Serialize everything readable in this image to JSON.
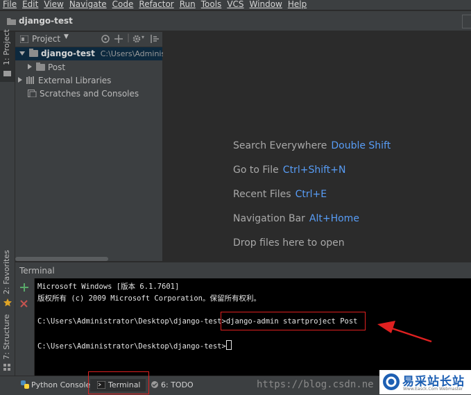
{
  "menu": [
    "File",
    "Edit",
    "View",
    "Navigate",
    "Code",
    "Refactor",
    "Run",
    "Tools",
    "VCS",
    "Window",
    "Help"
  ],
  "navbar": {
    "project_title": "django-test"
  },
  "left_strip": {
    "project_tab": "1: Project",
    "favorites_tab": "2: Favorites",
    "structure_tab": "7: Structure"
  },
  "project_panel": {
    "header_label": "Project",
    "tree": {
      "root_name": "django-test",
      "root_path": "C:\\Users\\Administrat",
      "child_post": "Post",
      "external_libraries": "External Libraries",
      "scratches": "Scratches and Consoles"
    }
  },
  "editor_hints": {
    "search_label": "Search Everywhere",
    "search_key": "Double Shift",
    "goto_label": "Go to File",
    "goto_key": "Ctrl+Shift+N",
    "recent_label": "Recent Files",
    "recent_key": "Ctrl+E",
    "navbar_label": "Navigation Bar",
    "navbar_key": "Alt+Home",
    "drop_label": "Drop files here to open"
  },
  "terminal": {
    "title": "Terminal",
    "line1": "Microsoft Windows [版本 6.1.7601]",
    "line2": "版权所有 (c) 2009 Microsoft Corporation。保留所有权利。",
    "prompt1": "C:\\Users\\Administrator\\Desktop\\django-test>",
    "command": "django-admin startproject Post",
    "prompt2": "C:\\Users\\Administrator\\Desktop\\django-test>"
  },
  "bottom_tabs": {
    "python_console": "Python Console",
    "terminal": "Terminal",
    "todo": "6: TODO"
  },
  "watermark": {
    "url": "https://blog.csdn.ne",
    "brand": "易采站长站",
    "brand_sub": "Www.Easck.Com Webmaster"
  },
  "colors": {
    "accent_key": "#589df6",
    "annotation_red": "#e02020",
    "add_green": "#59a869",
    "close_red": "#c75450"
  }
}
